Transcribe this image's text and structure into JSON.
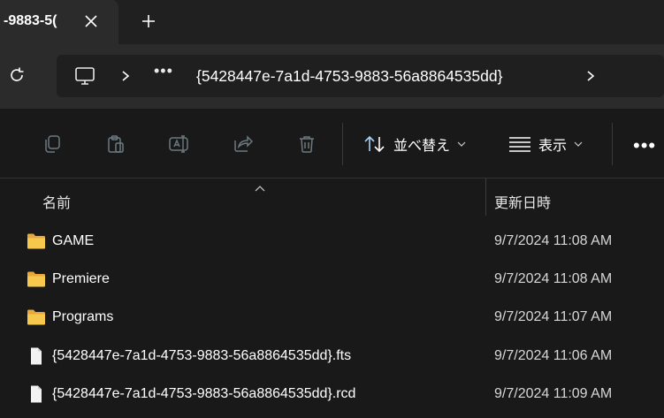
{
  "tab": {
    "title": "-9883-5("
  },
  "address": {
    "path": "{5428447e-7a1d-4753-9883-56a8864535dd}",
    "overflow": "•••"
  },
  "toolbar": {
    "sort_label": "並べ替え",
    "view_label": "表示",
    "more": "•••"
  },
  "columns": {
    "name": "名前",
    "date_modified": "更新日時"
  },
  "rows": [
    {
      "name": "GAME",
      "date": "9/7/2024 11:08 AM",
      "icon": "folder-icon"
    },
    {
      "name": "Premiere",
      "date": "9/7/2024 11:08 AM",
      "icon": "folder-icon"
    },
    {
      "name": "Programs",
      "date": "9/7/2024 11:07 AM",
      "icon": "folder-icon"
    },
    {
      "name": "{5428447e-7a1d-4753-9883-56a8864535dd}.fts",
      "date": "9/7/2024 11:06 AM",
      "icon": "file-icon"
    },
    {
      "name": "{5428447e-7a1d-4753-9883-56a8864535dd}.rcd",
      "date": "9/7/2024 11:09 AM",
      "icon": "file-icon"
    }
  ],
  "colors": {
    "folder": "#f0c04a",
    "file": "#e8e8e8",
    "disabled_icon": "#6c7a80",
    "background": "#191919"
  }
}
